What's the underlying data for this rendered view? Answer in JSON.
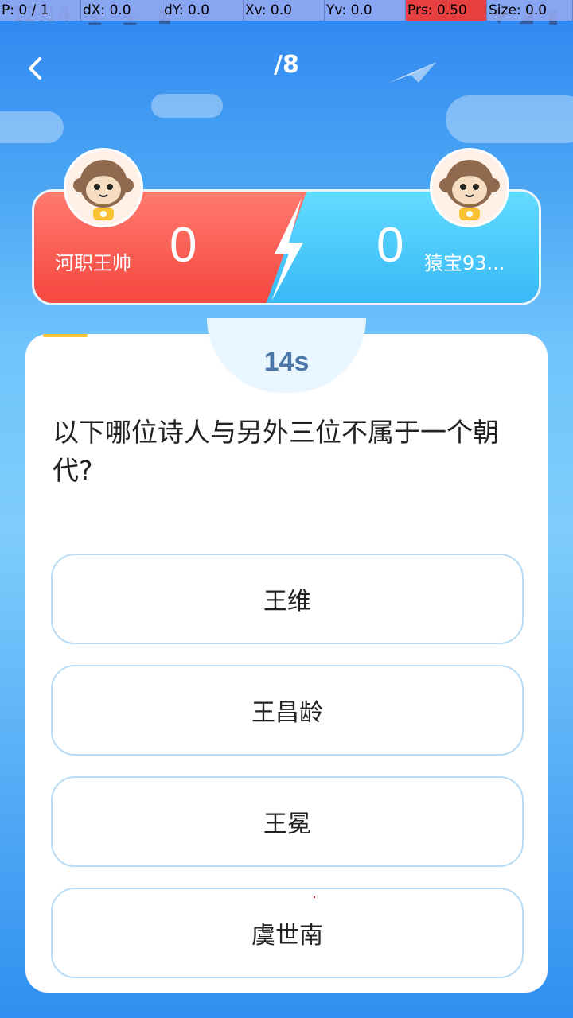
{
  "debug": {
    "p": "P: 0 / 1",
    "dx": "dX: 0.0",
    "dy": "dY: 0.0",
    "xv": "Xv: 0.0",
    "yv": "Yv: 0.0",
    "prs": "Prs: 0.50",
    "size": "Size: 0.0"
  },
  "status": {
    "time": "12:14"
  },
  "header": {
    "progress": "/8"
  },
  "players": {
    "left": {
      "name": "河职王帅",
      "score": "0"
    },
    "right": {
      "name": "猿宝93...",
      "score": "0"
    }
  },
  "timer": {
    "text": "14s"
  },
  "question": "以下哪位诗人与另外三位不属于一个朝代?",
  "options": [
    "王维",
    "王昌龄",
    "王冕",
    "虞世南"
  ],
  "colors": {
    "left_team": "#f5473f",
    "right_team": "#38b9f6",
    "timer_accent": "#f8c234",
    "timer_text": "#4a77a8"
  }
}
